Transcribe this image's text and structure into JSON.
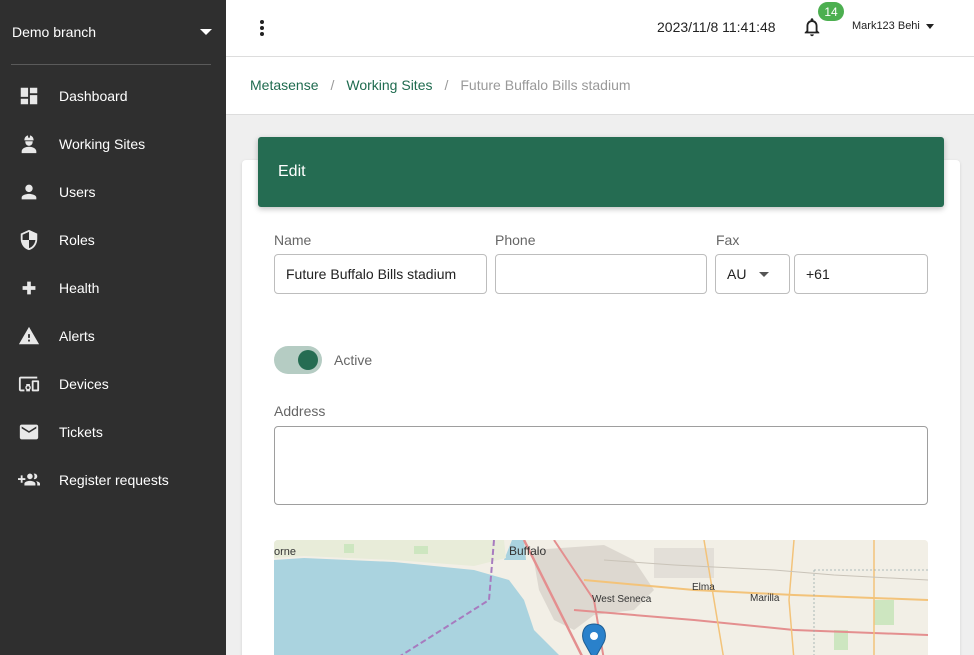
{
  "sidebar": {
    "branch": "Demo branch",
    "items": [
      {
        "label": "Dashboard",
        "icon": "dashboard-icon"
      },
      {
        "label": "Working Sites",
        "icon": "worker-icon"
      },
      {
        "label": "Users",
        "icon": "person-icon"
      },
      {
        "label": "Roles",
        "icon": "shield-icon"
      },
      {
        "label": "Health",
        "icon": "plus-icon"
      },
      {
        "label": "Alerts",
        "icon": "warning-icon"
      },
      {
        "label": "Devices",
        "icon": "devices-icon"
      },
      {
        "label": "Tickets",
        "icon": "mail-icon"
      },
      {
        "label": "Register requests",
        "icon": "add-group-icon"
      }
    ]
  },
  "topbar": {
    "datetime": "2023/11/8 11:41:48",
    "notification_count": "14",
    "user": "Mark123 Behi"
  },
  "breadcrumb": {
    "items": [
      "Metasense",
      "Working Sites"
    ],
    "current": "Future Buffalo Bills stadium"
  },
  "form": {
    "title": "Edit",
    "name_label": "Name",
    "name_value": "Future Buffalo Bills stadium",
    "phone_label": "Phone",
    "phone_value": "",
    "fax_label": "Fax",
    "fax_country": "AU",
    "fax_value": "+61",
    "active_label": "Active",
    "address_label": "Address",
    "address_value": ""
  },
  "map": {
    "labels": [
      "orne",
      "Buffalo",
      "West Seneca",
      "Elma",
      "Marilla"
    ]
  },
  "colors": {
    "accent": "#256c52",
    "sidebar_bg": "#2f2f2f",
    "badge": "#4caf50"
  }
}
